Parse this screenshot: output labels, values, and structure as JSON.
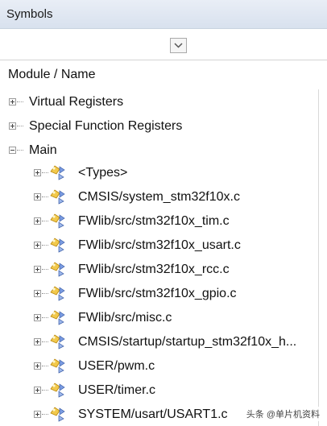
{
  "panel": {
    "title": "Symbols"
  },
  "header": {
    "column_label": "Module / Name"
  },
  "tree": {
    "top": [
      {
        "label": "Virtual Registers",
        "expanded": false
      },
      {
        "label": "Special Function Registers",
        "expanded": false
      },
      {
        "label": "Main",
        "expanded": true
      }
    ],
    "main_children": [
      "<Types>",
      "CMSIS/system_stm32f10x.c",
      "FWlib/src/stm32f10x_tim.c",
      "FWlib/src/stm32f10x_usart.c",
      "FWlib/src/stm32f10x_rcc.c",
      "FWlib/src/stm32f10x_gpio.c",
      "FWlib/src/misc.c",
      "CMSIS/startup/startup_stm32f10x_h...",
      "USER/pwm.c",
      "USER/timer.c",
      "SYSTEM/usart/USART1.c"
    ]
  },
  "icons": {
    "dropdown": "chevron-down-icon",
    "module": "module-icon"
  },
  "watermark": "头条 @单片机资料"
}
